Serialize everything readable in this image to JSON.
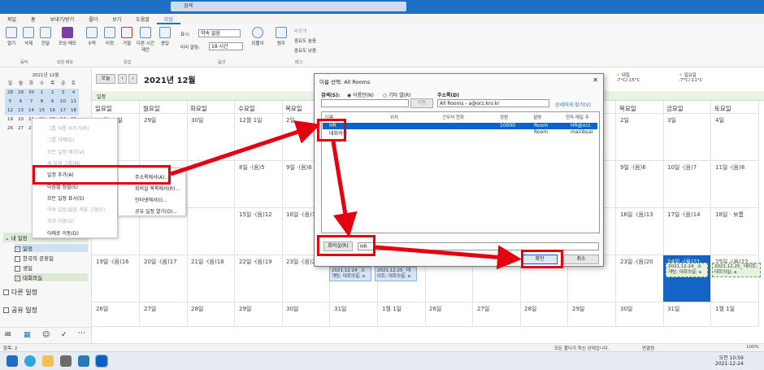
{
  "app": {
    "search_placeholder": "검색"
  },
  "tabs": [
    "파일",
    "홈",
    "보내기/받기",
    "폴더",
    "보기",
    "도움말",
    "모임"
  ],
  "ribbon": {
    "buttons": [
      "열기",
      "삭제",
      "전달",
      "모임 메모",
      "수락",
      "미정",
      "거절",
      "다른 시간 제안",
      "응답"
    ],
    "groups": [
      "동작",
      "모임 메모",
      "응답",
      "옵션",
      "태그"
    ],
    "show_as_label": "표시:",
    "show_as_value": "약속 없음",
    "reminder_label": "미리 알림:",
    "reminder_value": "18 시간",
    "recurrence": "되풀이",
    "categorize": "범주",
    "private": "비공개",
    "high": "중요도 높음",
    "low": "중요도 낮음"
  },
  "sidebar": {
    "month_title": "2021년 12월",
    "weekdays": [
      "일",
      "월",
      "화",
      "수",
      "목",
      "금",
      "토"
    ],
    "days": [
      "28",
      "29",
      "30",
      "1",
      "2",
      "3",
      "4",
      "5",
      "6",
      "7",
      "8",
      "9",
      "10",
      "11",
      "12",
      "13",
      "14",
      "15",
      "16",
      "17",
      "18",
      "19",
      "20",
      "21",
      "22",
      "23",
      "24",
      "25",
      "26",
      "27",
      "28",
      "29",
      "30",
      "31",
      "1"
    ],
    "my_calendars": "내 일정",
    "cals": [
      "일정",
      "한국의 공휴일",
      "생일",
      "대회의실"
    ],
    "other": "다른 일정",
    "shared": "공유 일정"
  },
  "calendar": {
    "today_btn": "오늘",
    "month_title": "2021년 12월",
    "band": "일정",
    "daynames": [
      "일요일",
      "월요일",
      "화요일",
      "수요일",
      "목요일",
      "금요일",
      "토요일",
      "일요일",
      "월요일",
      "화요일",
      "수요일",
      "목요일",
      "금요일",
      "토요일"
    ],
    "row0": [
      "11월 28일",
      "29일",
      "30일",
      "12월 1일",
      "2일",
      "3일",
      "4일",
      "",
      "",
      "",
      "",
      "2일",
      "3일",
      "4일"
    ],
    "row1": [
      "",
      "",
      "",
      "8일 ·(음)5",
      "9일 ·(음)6",
      "",
      "",
      "",
      "",
      "",
      "",
      "9일 ·(음)6",
      "10일 ·(음)7",
      "11일 ·(음)8"
    ],
    "row2": [
      "",
      "",
      "",
      "15일 ·(음)12",
      "16일 ·(음)13",
      "",
      "",
      "",
      "",
      "",
      "",
      "16일 ·(음)13",
      "17일 ·(음)14",
      "18일 · 보름"
    ],
    "row3": [
      "19일 ·(음)16",
      "20일 ·(음)17",
      "21일 ·(음)18",
      "22일 ·(음)19",
      "23일 ·(음)20",
      "",
      "",
      "",
      "",
      "",
      "",
      "23일 ·(음)20",
      "24일 ·(음)21",
      "25일 ·(음)22"
    ],
    "row4": [
      "26일",
      "27일",
      "28일",
      "29일",
      "30일",
      "31일",
      "1월 1일",
      "26일",
      "27일",
      "28일",
      "29일",
      "30일",
      "31일",
      "1월 1일"
    ],
    "events": {
      "e1": "2021.12.24_ 소개팅; 대회의실; a",
      "e2": "2021.12.25_ 데이트; 대회의실; a",
      "e3": "2021.12.24_ 소개팅; 대회의실; a",
      "e4": "2021.12.25_ 데이트; 대회의실; a"
    }
  },
  "weather": [
    {
      "day": "내일",
      "temp": "-7°C/-15°C"
    },
    {
      "day": "일요일",
      "temp": "-7°C/-11°C"
    }
  ],
  "context_menu": [
    "그룹 이름 바꾸기(R)",
    "그룹 삭제(D)",
    "모든 일정 제거(V)",
    "새 일정 그룹(N)",
    "일정 추가(A)",
    "이름별 정렬(S)",
    "모든 일정 표시(S)",
    "약속 있음/없음 색표 고정(F)",
    "위로 이동(U)",
    "아래로 이동(D)"
  ],
  "sub_menu": [
    "주소록에서(A)...",
    "회의실 목록에서(R)...",
    "인터넷에서(I)...",
    "공유 일정 열기(O)..."
  ],
  "dialog": {
    "title": "이름 선택: All Rooms",
    "search_label": "검색(S):",
    "radio1": "이름만(N)",
    "radio2": "기타 열(R)",
    "go_btn": "이동",
    "addr_label": "주소록(D)",
    "addr_value": "All Rooms - a@orz.kro.kr",
    "adv": "상세하게 찾기(V)",
    "columns": [
      "이름",
      "위치",
      "근무처 전화",
      "정원",
      "설명",
      "전자 메일 주"
    ],
    "rows": [
      [
        "HR",
        "",
        "",
        "10000",
        "Room",
        "HR@orz."
      ],
      [
        "대회의실",
        "",
        "",
        "",
        "Room",
        "mainbusi"
      ]
    ],
    "room_btn": "회의실(R)",
    "room_value": "HR",
    "ok": "확인",
    "cancel": "취소"
  },
  "status": {
    "items": "항목: 2",
    "sync": "모든 폴더가 최신 상태입니다.",
    "conn": "연결됨",
    "zoom": "100%"
  },
  "taskbar": {
    "time": "오전 10:59",
    "date": "2021-12-24"
  }
}
